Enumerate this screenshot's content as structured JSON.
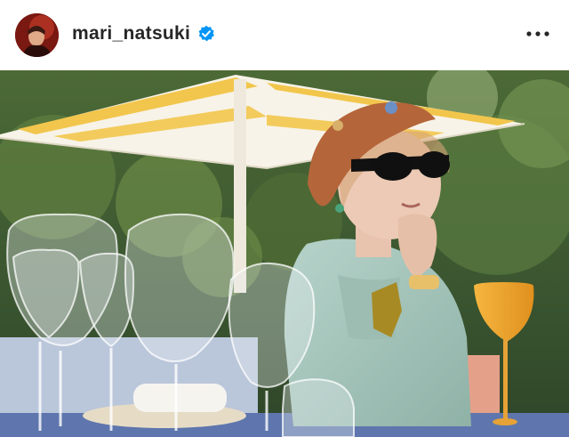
{
  "post": {
    "author": {
      "username": "mari_natsuki",
      "verified": true
    },
    "icons": {
      "verified": "verified-badge-icon",
      "more": "more-options-icon"
    },
    "colors": {
      "verified_blue": "#0095f6",
      "text": "#262626",
      "umbrella_stripe": "#f2c64c",
      "beret": "#b5653a",
      "shirt": "#a9c8bf",
      "orange_glass": "#f0a830"
    }
  }
}
